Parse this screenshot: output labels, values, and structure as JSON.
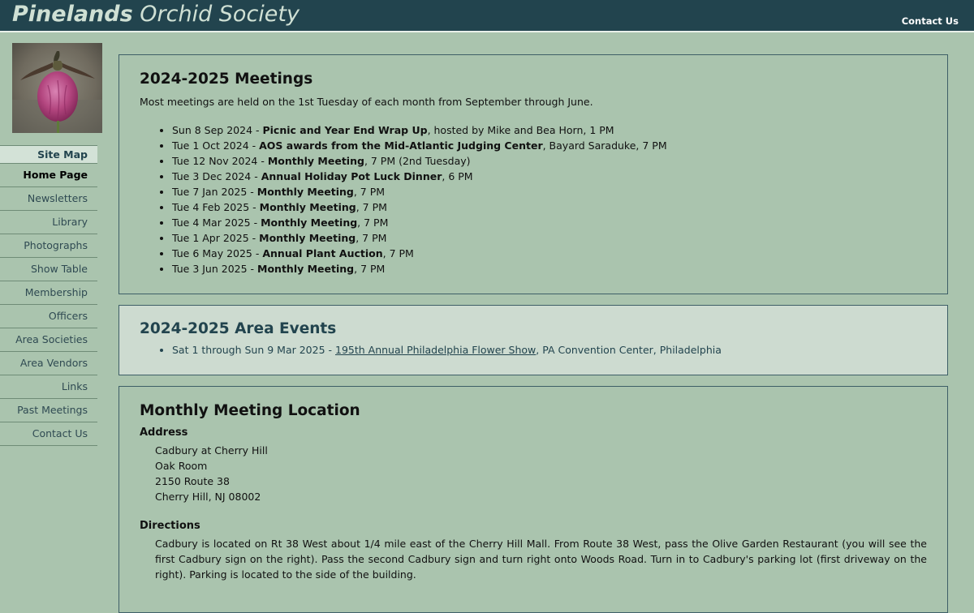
{
  "header": {
    "title_bold": "Pinelands",
    "title_rest": "Orchid Society",
    "contact_link": "Contact Us"
  },
  "logo": {
    "icon": "orchid-photo"
  },
  "sidebar": {
    "items": [
      {
        "label": "Site Map"
      },
      {
        "label": "Home Page"
      },
      {
        "label": "Newsletters"
      },
      {
        "label": "Library"
      },
      {
        "label": "Photographs"
      },
      {
        "label": "Show Table"
      },
      {
        "label": "Membership"
      },
      {
        "label": "Officers"
      },
      {
        "label": "Area Societies"
      },
      {
        "label": "Area Vendors"
      },
      {
        "label": "Links"
      },
      {
        "label": "Past Meetings"
      },
      {
        "label": "Contact Us"
      }
    ]
  },
  "meetings": {
    "title": "2024-2025 Meetings",
    "intro": "Most meetings are held on the 1st Tuesday of each month from September through June.",
    "items": [
      {
        "date": "Sun 8 Sep 2024 - ",
        "event": "Picnic and Year End Wrap Up",
        "rest": ", hosted by Mike and Bea Horn, 1 PM"
      },
      {
        "date": "Tue 1 Oct 2024 - ",
        "event": "AOS awards from the Mid-Atlantic Judging Center",
        "rest": ", Bayard Saraduke, 7 PM"
      },
      {
        "date": "Tue 12 Nov 2024 - ",
        "event": "Monthly Meeting",
        "rest": ", 7 PM (2nd Tuesday)"
      },
      {
        "date": "Tue 3 Dec 2024 - ",
        "event": "Annual Holiday Pot Luck Dinner",
        "rest": ", 6 PM"
      },
      {
        "date": "Tue 7 Jan 2025 - ",
        "event": "Monthly Meeting",
        "rest": ", 7 PM"
      },
      {
        "date": "Tue 4 Feb 2025 - ",
        "event": "Monthly Meeting",
        "rest": ", 7 PM"
      },
      {
        "date": "Tue 4 Mar 2025 - ",
        "event": "Monthly Meeting",
        "rest": ", 7 PM"
      },
      {
        "date": "Tue 1 Apr 2025 - ",
        "event": "Monthly Meeting",
        "rest": ", 7 PM"
      },
      {
        "date": "Tue 6 May 2025 - ",
        "event": "Annual Plant Auction",
        "rest": ", 7 PM"
      },
      {
        "date": "Tue 3 Jun 2025 - ",
        "event": "Monthly Meeting",
        "rest": ", 7 PM"
      }
    ]
  },
  "area_events": {
    "title": "2024-2025 Area Events",
    "items": [
      {
        "date": "Sat 1 through Sun 9 Mar 2025 - ",
        "link": "195th Annual Philadelphia Flower Show",
        "rest": ", PA Convention Center, Philadelphia"
      }
    ]
  },
  "location": {
    "title": "Monthly Meeting Location",
    "address_heading": "Address",
    "address_lines": [
      "Cadbury at Cherry Hill",
      "Oak Room",
      "2150 Route 38",
      "Cherry Hill, NJ 08002"
    ],
    "directions_heading": "Directions",
    "directions": "Cadbury is located on Rt 38 West about 1/4 mile east of the Cherry Hill Mall. From Route 38 West, pass the Olive Garden Restaurant (you will see the first Cadbury sign on the right). Pass the second Cadbury sign and turn right onto Woods Road. Turn in to Cadbury's parking lot (first driveway on the right). Parking is located to the side of the building."
  },
  "colors": {
    "page_bg": "#aac4ae",
    "header_bg": "#22444e",
    "accent": "#22444e",
    "events_panel_bg": "#cddbd0"
  }
}
